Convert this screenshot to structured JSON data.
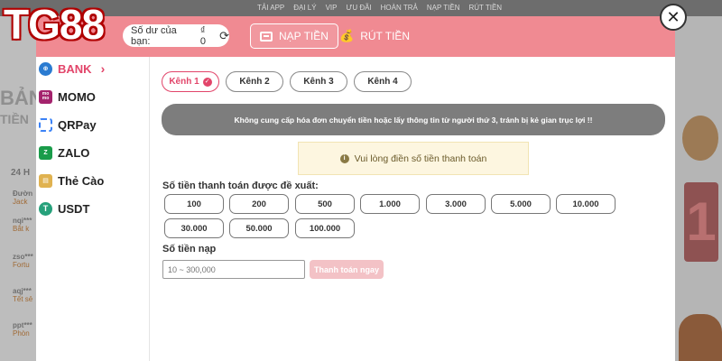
{
  "logo_text": "TG88",
  "background": {
    "nav": [
      "TẢI APP",
      "ĐẠI LÝ",
      "VIP",
      "ƯU ĐÃI",
      "HOÀN TRẢ",
      "NẠP TIỀN",
      "RÚT TIỀN"
    ],
    "left_title": "BẢN",
    "left_sub": "TIỀN",
    "left_heading": "24 H",
    "left_rows": [
      {
        "a": "Đườn",
        "b": "Jack"
      },
      {
        "a": "nqi***",
        "b": "Bắt k"
      },
      {
        "a": "zso***",
        "b": "Fortu"
      },
      {
        "a": "aqj***",
        "b": "Tết sẻ"
      },
      {
        "a": "ppt***",
        "b": "Phòn"
      }
    ],
    "right_digit": "1"
  },
  "header": {
    "balance_label": "Số dư của bạn:",
    "balance_value": "₫ 0",
    "deposit_tab": "NẠP TIỀN",
    "withdraw_tab": "RÚT TIỀN"
  },
  "sidebar": {
    "items": [
      {
        "label": "BANK",
        "icon": "bank-icon",
        "active": true
      },
      {
        "label": "MOMO",
        "icon": "momo-icon"
      },
      {
        "label": "QRPay",
        "icon": "qr-icon"
      },
      {
        "label": "ZALO",
        "icon": "zalo-icon"
      },
      {
        "label": "Thẻ Cào",
        "icon": "card-icon"
      },
      {
        "label": "USDT",
        "icon": "usdt-icon"
      }
    ]
  },
  "channels": [
    "Kênh 1",
    "Kênh 2",
    "Kênh 3",
    "Kênh 4"
  ],
  "warning_text": "Không cung cấp hóa đơn chuyển tiền hoặc lấy thông tin từ người thứ 3, tránh bị kẻ gian trục lợi !!",
  "notice_text": "Vui lòng điền số tiền thanh toán",
  "suggested_label": "Số tiền thanh toán được đề xuất:",
  "amounts": [
    "100",
    "200",
    "500",
    "1.000",
    "3.000",
    "5.000",
    "10.000",
    "30.000",
    "50.000",
    "100.000"
  ],
  "deposit_label": "Số tiền nạp",
  "amount_input": {
    "value": "",
    "placeholder": "10 ~ 300,000"
  },
  "pay_button": "Thanh toán ngay"
}
